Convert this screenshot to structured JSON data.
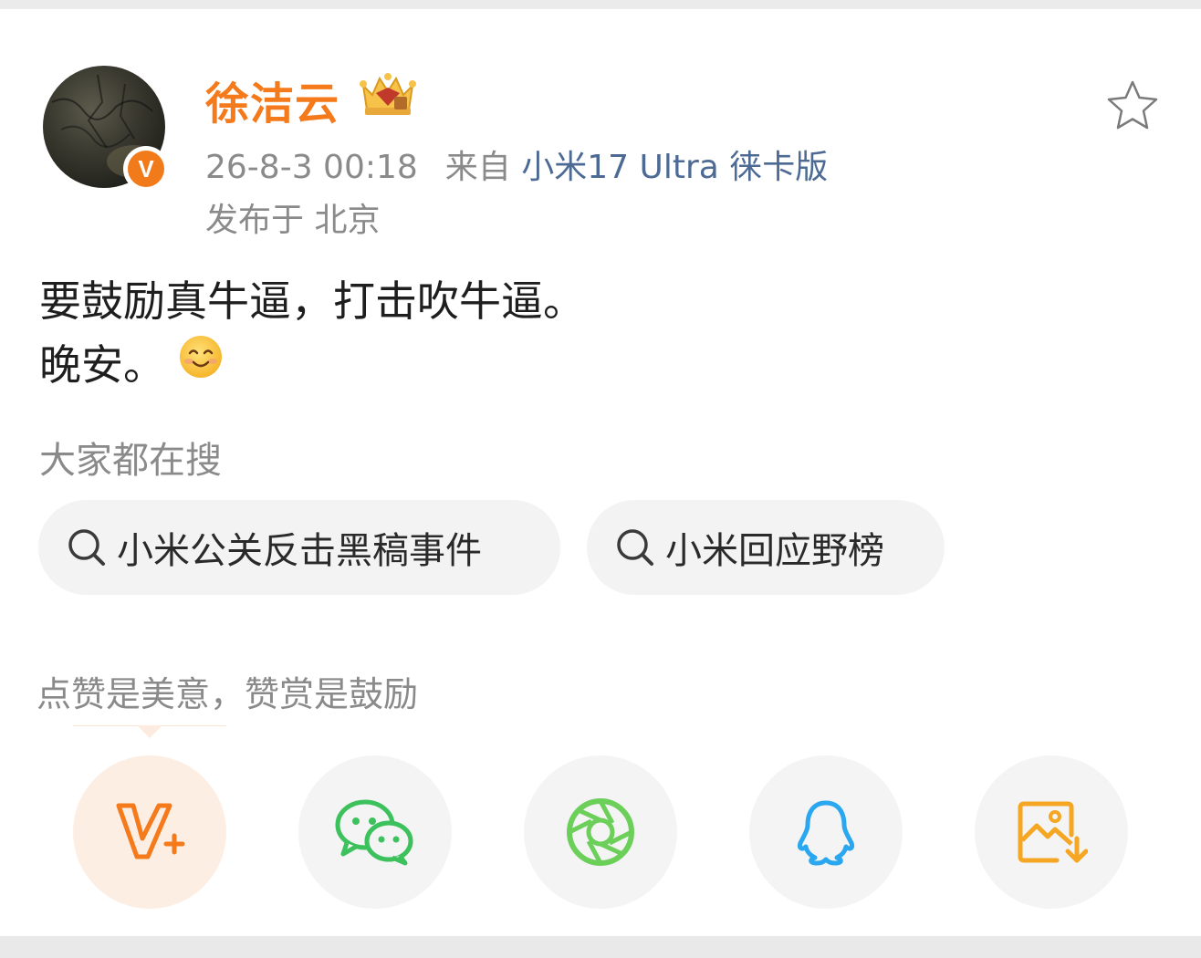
{
  "post": {
    "username": "徐洁云",
    "timestamp": "26-8-3 00:18",
    "source_prefix": "来自",
    "source_device": "小米17 Ultra 徕卡版",
    "location": "发布于 北京",
    "content_line1": "要鼓励真牛逼，打击吹牛逼。",
    "content_line2": "晚安。"
  },
  "icons": {
    "avatar": "avatar",
    "verified": "verified-v-badge",
    "crown": "vip-crown-icon",
    "favorite": "star-outline-icon",
    "smile": "smile-emoji",
    "search": "search-icon"
  },
  "verified_badge_text": "V",
  "search_section": {
    "title": "大家都在搜",
    "chips": [
      "小米公关反击黑稿事件",
      "小米回应野榜"
    ]
  },
  "reward": {
    "title": "点赞是美意，赞赏是鼓励"
  },
  "share_buttons": [
    {
      "icon": "vplus-reward-icon",
      "color": "#f47a1b"
    },
    {
      "icon": "wechat-icon",
      "color": "#3cc15c"
    },
    {
      "icon": "moments-icon",
      "color": "#6bcf5a"
    },
    {
      "icon": "qq-icon",
      "color": "#2aa7ef"
    },
    {
      "icon": "save-image-icon",
      "color": "#f5a623"
    }
  ],
  "colors": {
    "username": "#f47a1b",
    "link": "#4c6a94",
    "muted": "#8a8a8a",
    "chip_bg": "#f3f3f3"
  }
}
